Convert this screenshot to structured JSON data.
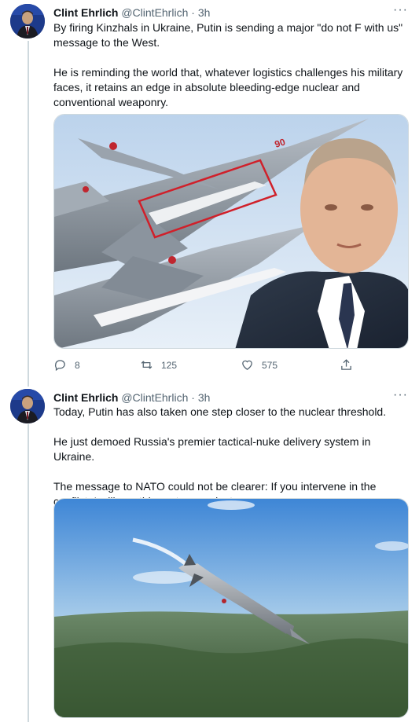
{
  "tweets": [
    {
      "author": {
        "name": "Clint Ehrlich",
        "handle": "@ClintEhrlich",
        "separator": "·",
        "time": "3h"
      },
      "more_icon": "more-horizontal-icon",
      "paragraphs": [
        "By firing Kinzhals in Ukraine, Putin is sending a major \"do not F with us\" message to the West.",
        "He is reminding the world that, whatever logistics challenges his military faces, it retains an edge in absolute bleeding-edge nuclear and conventional weaponry."
      ],
      "image": {
        "plane_number": "90"
      },
      "actions": {
        "reply_count": "8",
        "retweet_count": "125",
        "like_count": "575"
      }
    },
    {
      "author": {
        "name": "Clint Ehrlich",
        "handle": "@ClintEhrlich",
        "separator": "·",
        "time": "3h"
      },
      "more_icon": "more-horizontal-icon",
      "paragraphs": [
        "Today, Putin has also taken one step closer to the nuclear threshold.",
        "He just demoed Russia's premier tactical-nuke delivery system in Ukraine.",
        "The message to NATO could not be clearer: If you intervene in the conflict, I will use this system against you."
      ]
    }
  ],
  "colors": {
    "text": "#0f1419",
    "secondary": "#536471",
    "thread_line": "#cfd9de",
    "highlight_box": "#d0202a"
  }
}
